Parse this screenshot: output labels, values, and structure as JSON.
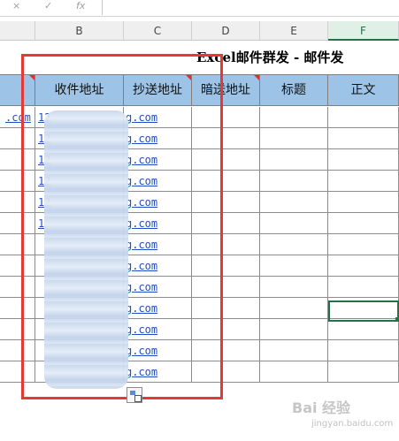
{
  "formula_bar": {
    "cancel_icon": "×",
    "confirm_icon": "✓",
    "fx_label": "fx",
    "content": ""
  },
  "columns": [
    "B",
    "C",
    "D",
    "E",
    "F"
  ],
  "active_column": "F",
  "sheet": {
    "title": "Excel邮件群发 - 邮件发",
    "headers": {
      "to": "收件地址",
      "cc": "抄送地址",
      "bcc": "暗送地址",
      "subject": "标题",
      "body": "正文"
    },
    "row_prefix_text": ".com",
    "rows": [
      {
        "prefix": "12",
        "suffix": "g.com"
      },
      {
        "prefix": "12",
        "suffix": "g.com"
      },
      {
        "prefix": "12",
        "suffix": "g.com"
      },
      {
        "prefix": "12",
        "suffix": "g.com"
      },
      {
        "prefix": "12",
        "suffix": "g.com"
      },
      {
        "prefix": "1",
        "suffix": "g.com"
      },
      {
        "prefix": "",
        "suffix": "g.com"
      },
      {
        "prefix": "",
        "suffix": "g.com"
      },
      {
        "prefix": "",
        "suffix": "g.com"
      },
      {
        "prefix": "",
        "suffix": "g.com"
      },
      {
        "prefix": "",
        "suffix": "g.com"
      },
      {
        "prefix": "",
        "suffix": "g.com"
      },
      {
        "prefix": "",
        "suffix": "g.com"
      }
    ]
  },
  "colors": {
    "header_fill": "#9dc3e6",
    "highlight_box": "#e53935",
    "selection": "#217346",
    "link": "#1f4fc2"
  },
  "watermark": {
    "text": "Bai 经验",
    "sub": "jingyan.baidu.com"
  }
}
